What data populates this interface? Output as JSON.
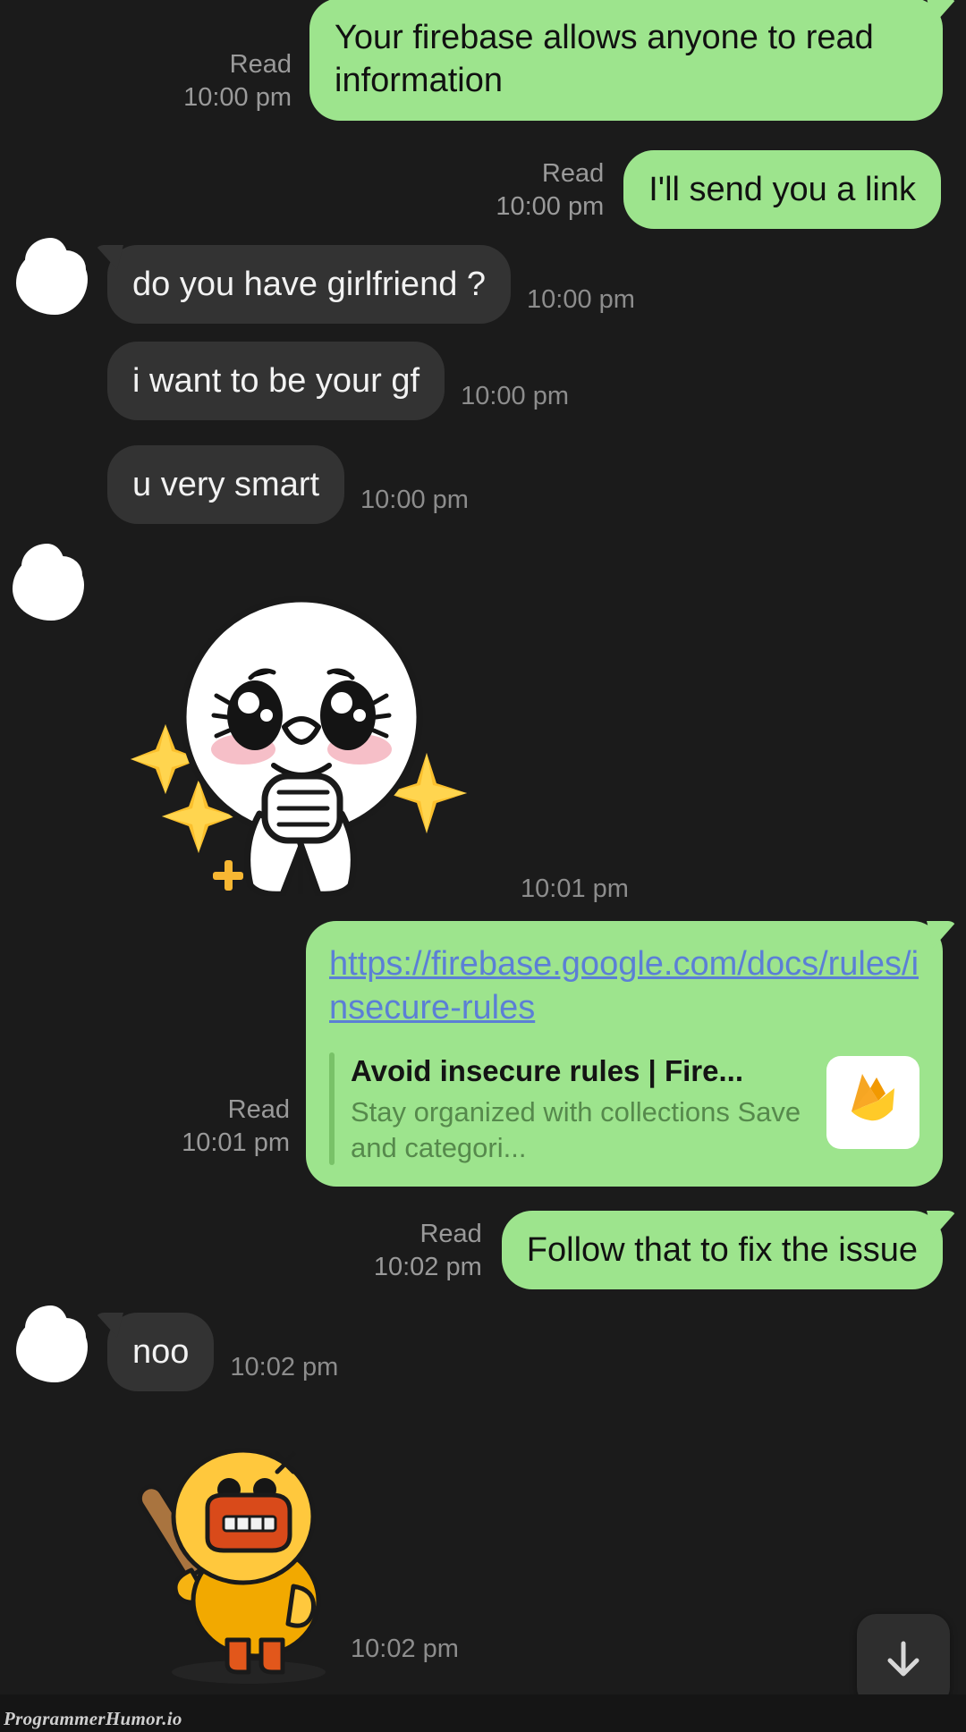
{
  "theme": {
    "background": "#1b1b1b",
    "outgoing_bubble": "#9de48d",
    "incoming_bubble": "#333333",
    "outgoing_text": "#111111",
    "incoming_text": "#f2f2f2",
    "meta_text": "#9a9a9a",
    "link_color": "#5b7fd6",
    "preview_accent": "#79c268",
    "preview_desc": "#56894c"
  },
  "labels": {
    "read": "Read"
  },
  "messages": [
    {
      "id": "msg-firebase-warning",
      "direction": "outgoing",
      "text": "Your firebase allows anyone to read information",
      "status": "Read",
      "time": "10:00 pm"
    },
    {
      "id": "msg-send-link",
      "direction": "outgoing",
      "text": "I'll send you a link",
      "status": "Read",
      "time": "10:00 pm"
    },
    {
      "id": "msg-girlfriend",
      "direction": "incoming",
      "text": "do you have girlfriend  ?",
      "time": "10:00 pm"
    },
    {
      "id": "msg-be-your-gf",
      "direction": "incoming",
      "text": "i want to be your gf",
      "time": "10:00 pm"
    },
    {
      "id": "msg-very-smart",
      "direction": "incoming",
      "text": "u very smart",
      "time": "10:00 pm"
    },
    {
      "id": "msg-sticker-shy",
      "direction": "incoming",
      "type": "sticker",
      "sticker": "cony-shy-sparkle-sticker",
      "time": "10:01 pm"
    },
    {
      "id": "msg-link-preview",
      "direction": "outgoing",
      "type": "link",
      "url": "https://firebase.google.com/docs/rules/insecure-rules",
      "preview": {
        "title": "Avoid insecure rules | Fire...",
        "description": "Stay organized with collections Save and categori...",
        "thumbnail": "firebase-logo-icon"
      },
      "status": "Read",
      "time": "10:01 pm"
    },
    {
      "id": "msg-follow-that",
      "direction": "outgoing",
      "text": "Follow that to fix the issue",
      "status": "Read",
      "time": "10:02 pm"
    },
    {
      "id": "msg-noo",
      "direction": "incoming",
      "text": "noo",
      "time": "10:02 pm"
    },
    {
      "id": "msg-sticker-angry-duck",
      "direction": "incoming",
      "type": "sticker",
      "sticker": "sally-duck-baseball-bat-sticker",
      "time": "10:02 pm"
    }
  ],
  "controls": {
    "scroll_to_bottom": "arrow-down-icon"
  },
  "watermark": {
    "text": "ProgrammerHumor.io"
  }
}
